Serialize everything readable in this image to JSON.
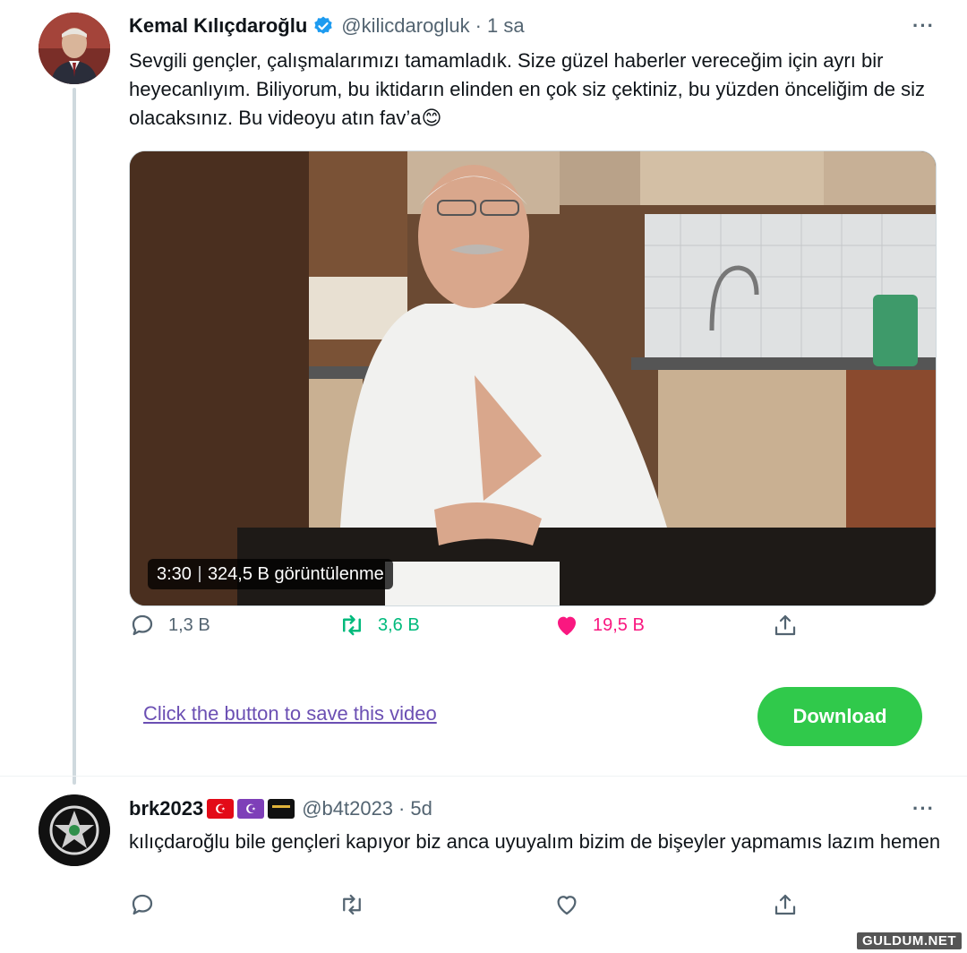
{
  "tweet": {
    "author": {
      "display_name": "Kemal Kılıçdaroğlu",
      "handle": "@kilicdarogluk",
      "time": "1 sa",
      "verified": true
    },
    "text": "Sevgili gençler, çalışmalarımızı tamamladık. Size güzel haberler vereceğim için ayrı bir heyecanlıyım. Biliyorum, bu iktidarın elinden en çok siz çektiniz, bu yüzden önceliğim de siz olacaksınız. Bu videoyu atın fav’a😊",
    "video": {
      "duration": "3:30",
      "views": "324,5 B görüntülenme"
    },
    "actions": {
      "reply_count": "1,3 B",
      "retweet_count": "3,6 B",
      "like_count": "19,5 B"
    },
    "more_icon": "more-dots-icon"
  },
  "save_bar": {
    "link_text": "Click the button to save this video",
    "button_label": "Download"
  },
  "reply": {
    "author": {
      "display_name": "brk2023",
      "handle": "@b4t2023",
      "time": "5d",
      "flags": [
        "turkey-flag-icon",
        "crescent-star-icon",
        "kaaba-icon"
      ]
    },
    "text": "kılıçdaroğlu bile gençleri kapıyor biz anca uyuyalım bizim de bişeyler yapmamıs lazım hemen"
  },
  "watermark": "GULDUM.NET",
  "colors": {
    "verified": "#1d9bf0",
    "like": "#f91880",
    "retweet": "#00ba7c",
    "download": "#30c94b",
    "link": "#6b4fb3"
  }
}
